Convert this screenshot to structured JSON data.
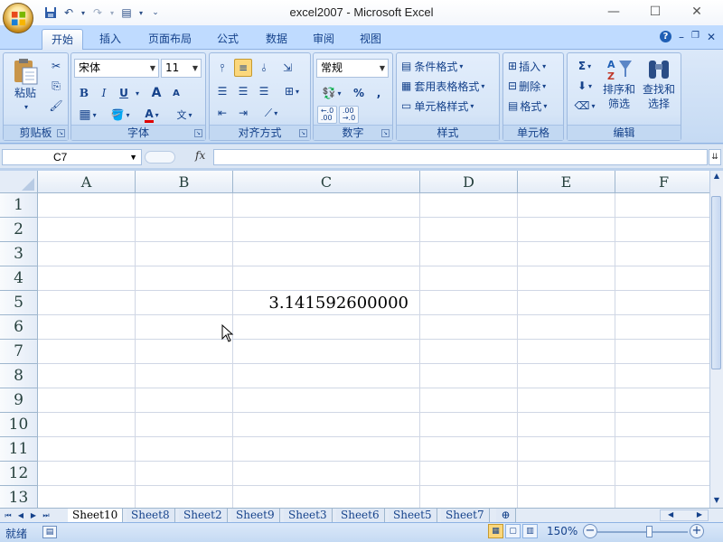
{
  "window": {
    "title": "excel2007 - Microsoft Excel",
    "controls": [
      "minimize",
      "maximize",
      "close"
    ]
  },
  "quick_access": [
    "save-icon",
    "undo-icon",
    "redo-icon",
    "print-preview-icon",
    "customize-icon"
  ],
  "ribbon_tabs": {
    "home": "开始",
    "insert": "插入",
    "page_layout": "页面布局",
    "formulas": "公式",
    "data": "数据",
    "review": "审阅",
    "view": "视图"
  },
  "ribbon": {
    "clipboard": {
      "title": "剪贴板",
      "paste": "粘贴"
    },
    "font": {
      "title": "字体",
      "font_name": "宋体",
      "font_size": "11",
      "bold": "B",
      "italic": "I",
      "underline": "U",
      "grow": "A",
      "shrink": "A",
      "font_color": "A",
      "phonetic": "文"
    },
    "alignment": {
      "title": "对齐方式"
    },
    "number": {
      "title": "数字",
      "format": "常规",
      "percent": "%",
      "comma": ","
    },
    "styles": {
      "title": "样式",
      "conditional": "条件格式",
      "table_format": "套用表格格式",
      "cell_styles": "单元格样式"
    },
    "cells": {
      "title": "单元格",
      "insert": "插入",
      "delete": "删除",
      "format": "格式"
    },
    "editing": {
      "title": "编辑",
      "sum": "Σ",
      "sort_filter_1": "排序和",
      "sort_filter_2": "筛选",
      "find_select_1": "查找和",
      "find_select_2": "选择"
    }
  },
  "formula_bar": {
    "name_box": "C7",
    "fx": "fx",
    "formula": ""
  },
  "columns": [
    "A",
    "B",
    "C",
    "D",
    "E",
    "F"
  ],
  "rows": [
    "1",
    "2",
    "3",
    "4",
    "5",
    "6",
    "7",
    "8",
    "9",
    "10",
    "11",
    "12",
    "13"
  ],
  "cells": {
    "C5": "3.141592600000"
  },
  "sheets": [
    "Sheet10",
    "Sheet8",
    "Sheet2",
    "Sheet9",
    "Sheet3",
    "Sheet6",
    "Sheet5",
    "Sheet7"
  ],
  "active_sheet": "Sheet10",
  "status": {
    "mode": "就绪",
    "zoom": "150%"
  }
}
